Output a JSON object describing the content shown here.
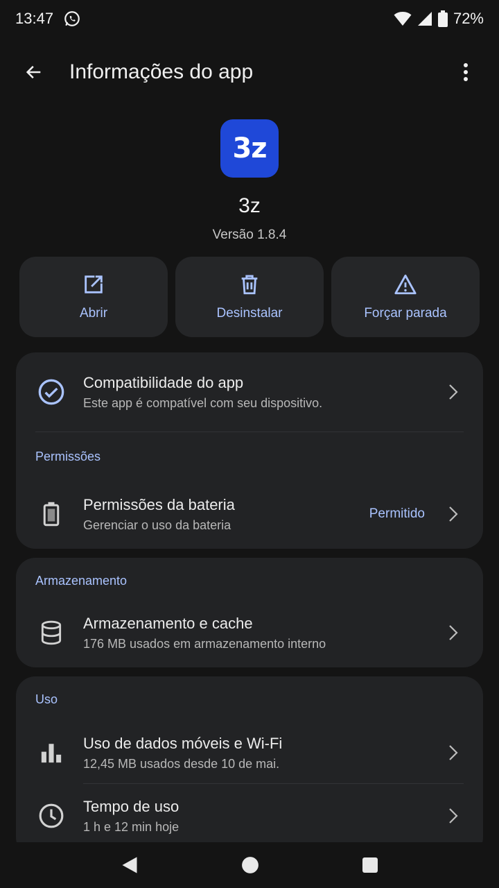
{
  "status_bar": {
    "time": "13:47",
    "battery": "72%"
  },
  "app_bar": {
    "title": "Informações do app"
  },
  "app": {
    "icon_text": "3z",
    "name": "3z",
    "version": "Versão 1.8.4",
    "icon_color": "#1f48d8"
  },
  "actions": [
    {
      "label": "Abrir",
      "icon": "open-external-icon"
    },
    {
      "label": "Desinstalar",
      "icon": "trash-icon"
    },
    {
      "label": "Forçar parada",
      "icon": "warning-icon"
    }
  ],
  "compat": {
    "title": "Compatibilidade do app",
    "subtitle": "Este app é compatível com seu dispositivo."
  },
  "permissions": {
    "section": "Permissões",
    "battery": {
      "title": "Permissões da bateria",
      "subtitle": "Gerenciar o uso da bateria",
      "value": "Permitido"
    }
  },
  "storage": {
    "section": "Armazenamento",
    "cache": {
      "title": "Armazenamento e cache",
      "subtitle": "176 MB usados em armazenamento interno"
    }
  },
  "usage": {
    "section": "Uso",
    "data": {
      "title": "Uso de dados móveis e Wi-Fi",
      "subtitle": "12,45 MB usados desde 10 de mai."
    },
    "screen_time": {
      "title": "Tempo de uso",
      "subtitle": "1 h e 12 min hoje"
    }
  },
  "colors": {
    "background": "#141414",
    "card": "#222325",
    "accent": "#aac3ff"
  }
}
